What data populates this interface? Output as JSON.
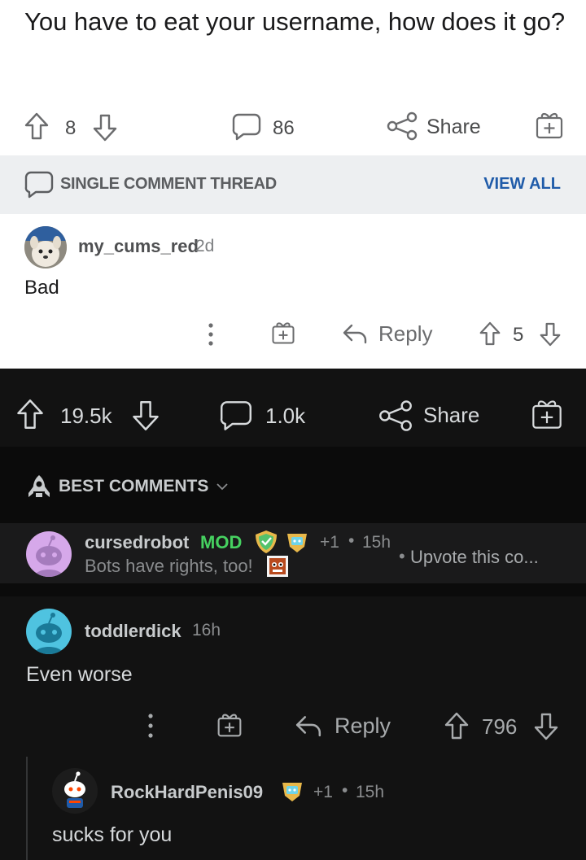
{
  "post": {
    "title": "You have to eat your username, how does it go?",
    "upvotes": "8",
    "comments": "86",
    "share_label": "Share"
  },
  "thread_bar": {
    "label": "SINGLE COMMENT THREAD",
    "view_all": "VIEW ALL"
  },
  "comment1": {
    "username": "my_cums_red",
    "time": "2d",
    "body": "Bad",
    "reply_label": "Reply",
    "votes": "5"
  },
  "dark_post": {
    "upvotes": "19.5k",
    "comments": "1.0k",
    "share_label": "Share"
  },
  "sort": {
    "label": "BEST COMMENTS"
  },
  "pinned_comment": {
    "username": "cursedrobot",
    "mod_label": "MOD",
    "award_count": "+1",
    "time": "15h",
    "body": "Bots have rights, too!",
    "preview": "Upvote this co..."
  },
  "comment2": {
    "username": "toddlerdick",
    "time": "16h",
    "body": "Even worse",
    "reply_label": "Reply",
    "votes": "796"
  },
  "comment3": {
    "username": "RockHardPenis09",
    "award_count": "+1",
    "time": "15h",
    "body": "sucks for you"
  },
  "colors": {
    "mod_green": "#46d160",
    "link_blue": "#1f5ba9",
    "dark_bg": "#121212"
  }
}
